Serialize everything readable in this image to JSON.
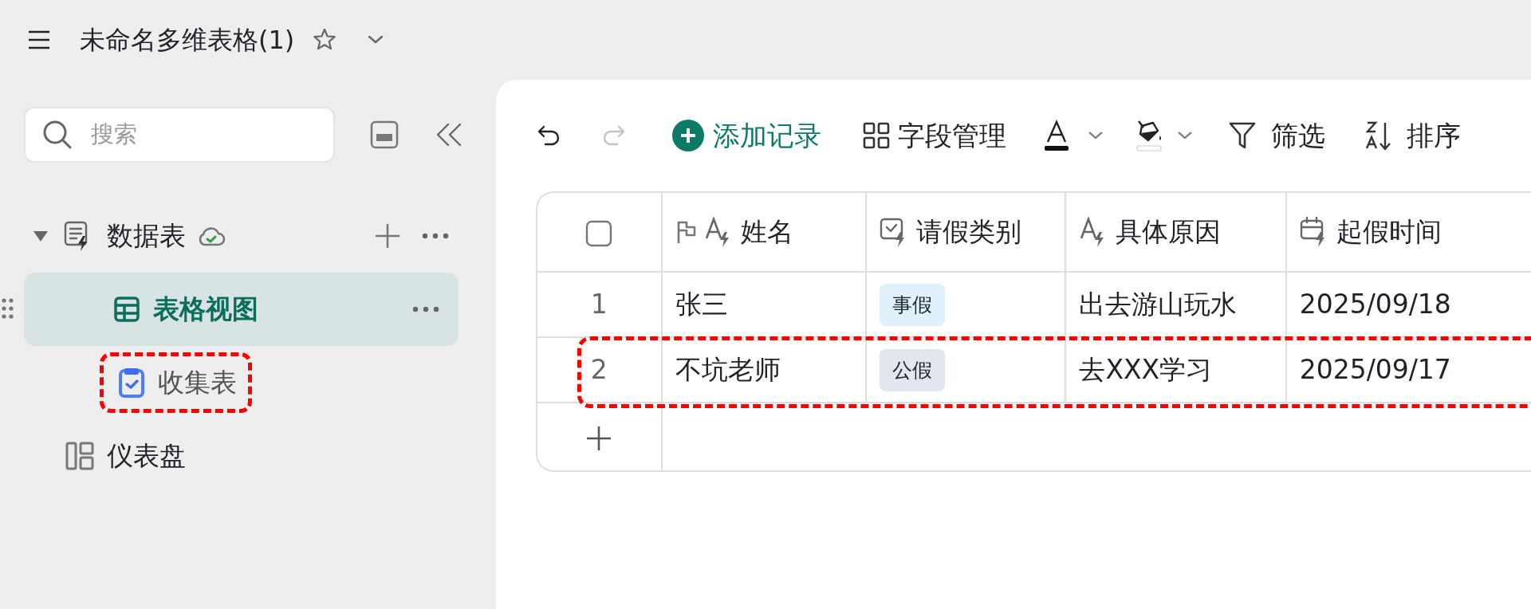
{
  "document": {
    "title": "未命名多维表格(1)",
    "starred": false
  },
  "sidebar": {
    "search": {
      "placeholder": "搜索"
    },
    "tree": [
      {
        "label": "数据表",
        "kind": "table",
        "expanded": true,
        "synced": true,
        "selected": false,
        "highlighted": false,
        "children": [
          {
            "label": "表格视图",
            "kind": "grid",
            "selected": true,
            "highlighted": false
          },
          {
            "label": "收集表",
            "kind": "form",
            "selected": false,
            "highlighted": true
          }
        ]
      },
      {
        "label": "仪表盘",
        "kind": "dashboard",
        "selected": false,
        "highlighted": false
      }
    ]
  },
  "toolbar": [
    {
      "kind": "undo",
      "disabled": false
    },
    {
      "kind": "redo",
      "disabled": true
    },
    {
      "kind": "add",
      "label": "添加记录"
    },
    {
      "kind": "fields",
      "label": "字段管理"
    },
    {
      "kind": "text_color"
    },
    {
      "kind": "fill_color"
    },
    {
      "kind": "filter",
      "label": "筛选"
    },
    {
      "kind": "sort",
      "label": "排序"
    }
  ],
  "table": {
    "select_all": {
      "checked": false
    },
    "columns": [
      {
        "label": "姓名",
        "kind": "text",
        "primary": true
      },
      {
        "label": "请假类别",
        "kind": "select",
        "primary": false
      },
      {
        "label": "具体原因",
        "kind": "text",
        "primary": false
      },
      {
        "label": "起假时间",
        "kind": "date",
        "primary": false
      }
    ],
    "rows": [
      {
        "number": "1",
        "highlighted": false,
        "cells": [
          {
            "text": "张三"
          },
          {
            "text": "事假",
            "color": "#e1f1fb"
          },
          {
            "text": "出去游山玩水"
          },
          {
            "text": "2025/09/18"
          }
        ]
      },
      {
        "number": "2",
        "highlighted": true,
        "cells": [
          {
            "text": "不坑老师"
          },
          {
            "text": "公假",
            "color": "#e2e6ee"
          },
          {
            "text": "去XXX学习"
          },
          {
            "text": "2025/09/17"
          }
        ]
      }
    ]
  }
}
